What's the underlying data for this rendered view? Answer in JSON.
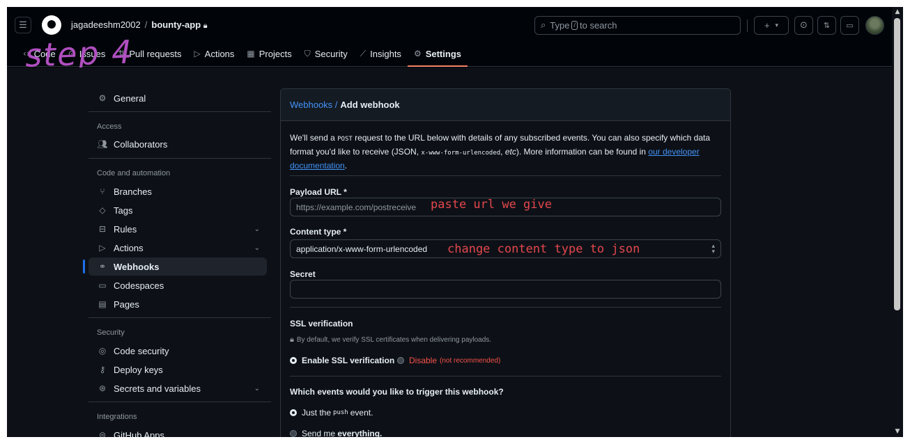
{
  "header": {
    "owner": "jagadeeshm2002",
    "separator": "/",
    "repo": "bounty-app",
    "search_prefix": "Type",
    "search_key": "/",
    "search_suffix": "to search"
  },
  "annotation": {
    "step": "step 4"
  },
  "tabs": [
    {
      "label": "Code",
      "icon": "code-icon"
    },
    {
      "label": "Issues",
      "icon": "issue-icon"
    },
    {
      "label": "Pull requests",
      "icon": "pull-request-icon"
    },
    {
      "label": "Actions",
      "icon": "play-icon"
    },
    {
      "label": "Projects",
      "icon": "table-icon"
    },
    {
      "label": "Security",
      "icon": "shield-icon"
    },
    {
      "label": "Insights",
      "icon": "graph-icon"
    },
    {
      "label": "Settings",
      "icon": "gear-icon"
    }
  ],
  "sidebar": {
    "general": "General",
    "access_heading": "Access",
    "collaborators": "Collaborators",
    "code_heading": "Code and automation",
    "branches": "Branches",
    "tags": "Tags",
    "rules": "Rules",
    "actions": "Actions",
    "webhooks": "Webhooks",
    "codespaces": "Codespaces",
    "pages": "Pages",
    "security_heading": "Security",
    "code_security": "Code security",
    "deploy_keys": "Deploy keys",
    "secrets": "Secrets and variables",
    "integrations_heading": "Integrations",
    "github_apps": "GitHub Apps"
  },
  "panel": {
    "crumb_link": "Webhooks /",
    "crumb_current": "Add webhook",
    "intro_1": "We'll send a",
    "intro_post": "POST",
    "intro_2": "request to the URL below with details of any subscribed events. You can also specify which data format you'd like to receive (JSON,",
    "intro_code": "x-www-form-urlencoded",
    "intro_etc": "etc",
    "intro_3": "). More information can be found in",
    "intro_link": "our developer documentation",
    "intro_end": ".",
    "payload_label": "Payload URL *",
    "payload_placeholder": "https://example.com/postreceive",
    "payload_note": "paste url we give",
    "content_label": "Content type *",
    "content_value": "application/x-www-form-urlencoded",
    "content_note": "change content type to json",
    "secret_label": "Secret",
    "ssl_label": "SSL verification",
    "ssl_hint": "By default, we verify SSL certificates when delivering payloads.",
    "ssl_enable": "Enable SSL verification",
    "ssl_disable": "Disable",
    "ssl_disable_note": "(not recommended)",
    "events_label": "Which events would you like to trigger this webhook?",
    "just_push_1": "Just the",
    "just_push_code": "push",
    "just_push_2": "event.",
    "send_everything_1": "Send me",
    "send_everything_2": "everything."
  }
}
